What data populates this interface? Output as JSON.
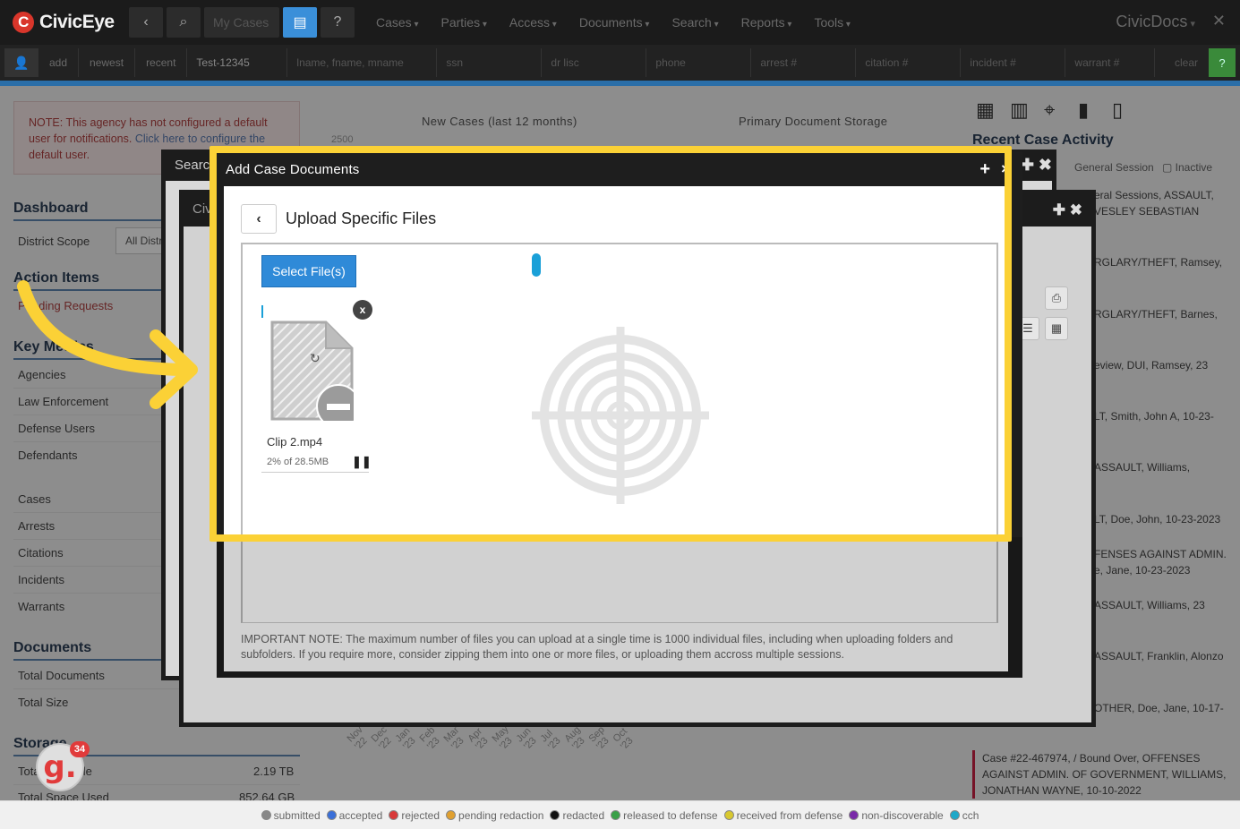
{
  "app": {
    "brand": "CivicEye",
    "brand_logo": "C",
    "right_title": "CivicDocs",
    "close": "✕"
  },
  "topbar": {
    "my_cases_placeholder": "My Cases",
    "icons": [
      "back-icon",
      "search-icon",
      "cases-icon",
      "help-icon"
    ],
    "menu": [
      "Cases",
      "Parties",
      "Access",
      "Documents",
      "Search",
      "Reports",
      "Tools"
    ]
  },
  "searchbar": {
    "links": [
      "add",
      "newest",
      "recent"
    ],
    "fields": [
      "Test-12345",
      "lname, fname, mname",
      "ssn",
      "dr lisc",
      "phone",
      "arrest #",
      "citation #",
      "incident #",
      "warrant #"
    ],
    "clear": "clear",
    "help": "?"
  },
  "notice": {
    "text1": "NOTE: This agency has not configured a default user for notifications. ",
    "link": "Click here to configure the",
    "text2": " default user."
  },
  "sidebar": {
    "dashboard": "Dashboard",
    "district_scope": "District Scope",
    "district_select": "All Distr",
    "action_items": "Action Items",
    "pending": "Pending Requests",
    "key_metrics": "Key Metrics",
    "metrics": [
      "Agencies",
      "Law Enforcement",
      "Defense Users",
      "Defendants"
    ],
    "entities": [
      "Cases",
      "Arrests",
      "Citations",
      "Incidents",
      "Warrants"
    ],
    "documents": "Documents",
    "doc_items": [
      "Total Documents",
      "Total Size"
    ],
    "storage": "Storage",
    "storage_available_label": "Total Available",
    "storage_available_value": "2.19 TB",
    "storage_used_label": "Total Space Used",
    "storage_used_value": "852.64 GB"
  },
  "charts": {
    "new_cases": "New Cases (last 12 months)",
    "storage": "Primary Document Storage",
    "y_tick": "2500",
    "months": [
      "Nov '22",
      "Dec '22",
      "Jan '23",
      "Feb '23",
      "Mar '23",
      "Apr '23",
      "May '23",
      "Jun '23",
      "Jul '23",
      "Aug '23",
      "Sep '23",
      "Oct '23"
    ]
  },
  "right_panel": {
    "title": "Recent Case Activity",
    "filter": "General Session",
    "filter2": "Inactive",
    "entries": [
      "eral Sessions, ASSAULT, VESLEY SEBASTIAN",
      "RGLARY/THEFT, Ramsey,",
      "RGLARY/THEFT, Barnes,",
      "eview, DUI, Ramsey, 23",
      "LT, Smith, John A, 10-23-",
      "ASSAULT, Williams,",
      "LT, Doe, John, 10-23-2023",
      "FENSES AGAINST ADMIN. e, Jane, 10-23-2023",
      "ASSAULT, Williams, 23",
      "ASSAULT, Franklin, Alonzo",
      "OTHER, Doe, Jane, 10-17-"
    ],
    "last_case": "Case #22-467974, / Bound Over, OFFENSES AGAINST ADMIN. OF GOVERNMENT, WILLIAMS, JONATHAN WAYNE, 10-10-2022"
  },
  "legend": [
    {
      "label": "submitted",
      "color": "#888888"
    },
    {
      "label": "accepted",
      "color": "#3a6fd8"
    },
    {
      "label": "rejected",
      "color": "#d83a3a"
    },
    {
      "label": "pending redaction",
      "color": "#e0a030"
    },
    {
      "label": "redacted",
      "color": "#111111"
    },
    {
      "label": "released to defense",
      "color": "#3aa048"
    },
    {
      "label": "received from defense",
      "color": "#d8c830"
    },
    {
      "label": "non-discoverable",
      "color": "#7a2aa8"
    },
    {
      "label": "cch",
      "color": "#20a8c8"
    }
  ],
  "background_windows": {
    "win1_title": "Searc",
    "win2_title": "Civ"
  },
  "modal": {
    "title": "Add Case Documents",
    "plus": "+",
    "close": "×",
    "subtitle": "Upload Specific Files",
    "select_button": "Select File(s)",
    "file": {
      "name": "Clip 2.mp4",
      "progress": "2% of 28.5MB",
      "progress_fraction": 0.02,
      "remove": "x",
      "pause": "❚❚"
    },
    "note": "IMPORTANT NOTE: The maximum number of files you can upload at a single time is 1000 individual files, including when uploading folders and subfolders. If you require more, consider zipping them into one or more files, or uploading them accross multiple sessions."
  },
  "badge": {
    "letter": "g.",
    "count": "34"
  },
  "colors": {
    "highlight": "#fbd136",
    "accent": "#2f8ad8",
    "topbar": "#1b1b1b"
  }
}
